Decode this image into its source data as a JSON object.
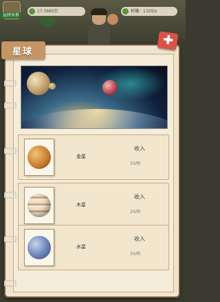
{
  "hud": {
    "badge": "玩转世界",
    "money": "17.3665亿",
    "income": "秒赚：1320/s"
  },
  "panel": {
    "title": "星球",
    "close_symbol": "✚"
  },
  "planets": [
    {
      "name": "金星",
      "income_label": "收入",
      "income_value": "10/秒"
    },
    {
      "name": "木星",
      "income_label": "收入",
      "income_value": "20/秒"
    },
    {
      "name": "水星",
      "income_label": "收入",
      "income_value": "30/秒"
    }
  ],
  "colors": {
    "panel_bg": "#efe4cf",
    "title_tab": "#c49565",
    "close_button": "#d9524a"
  },
  "icons": {
    "close": "plus-close-icon",
    "money": "cash-icon",
    "income": "coin-icon"
  }
}
